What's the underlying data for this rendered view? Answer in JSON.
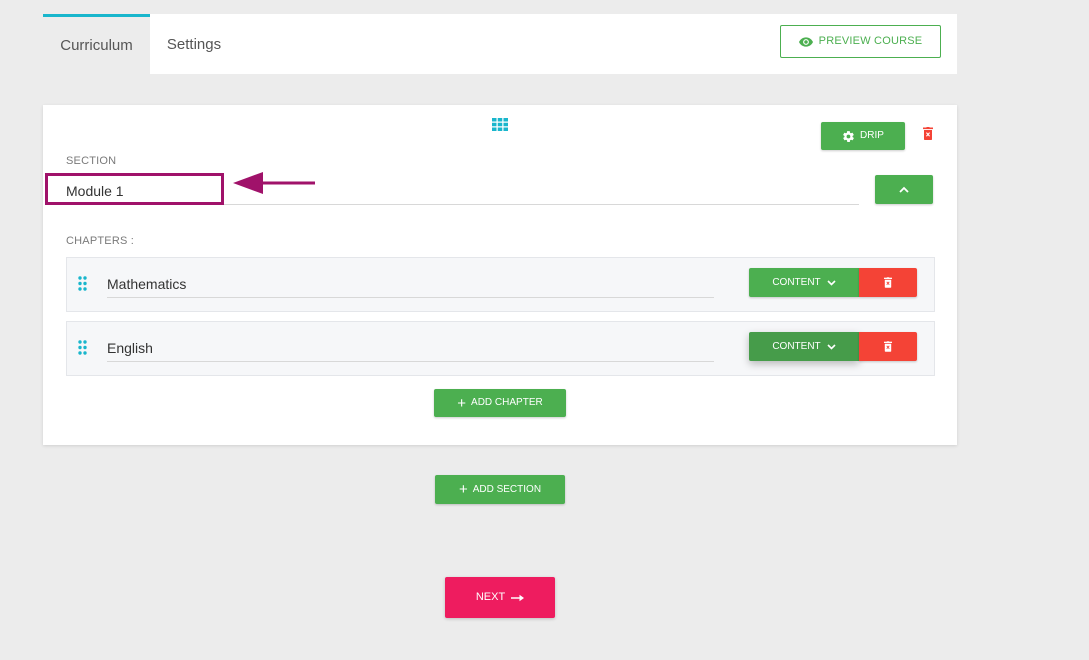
{
  "tabs": [
    {
      "label": "Curriculum",
      "active": true
    },
    {
      "label": "Settings",
      "active": false
    }
  ],
  "header": {
    "preview_label": "PREVIEW COURSE",
    "preview_icon": "eye-icon"
  },
  "section": {
    "label": "SECTION",
    "name": "Module 1",
    "drip_label": "DRIP",
    "drip_icon": "gear-icon",
    "delete_icon": "trash-icon",
    "collapse_icon": "chevron-up-icon",
    "reorder_icon": "grid-icon",
    "chapters_label": "CHAPTERS :",
    "chapters": [
      {
        "name": "Mathematics",
        "content_label": "CONTENT",
        "content_icon": "chevron-down-icon",
        "delete_icon": "trash-icon"
      },
      {
        "name": "English",
        "content_label": "CONTENT",
        "content_icon": "chevron-down-icon",
        "delete_icon": "trash-icon"
      }
    ],
    "add_chapter_label": "ADD CHAPTER"
  },
  "add_section_label": "ADD SECTION",
  "next_label": "NEXT",
  "annotation": {
    "highlight_color": "#a0126a",
    "arrow_icon": "arrow-left-icon"
  },
  "colors": {
    "accent_teal": "#19b6cc",
    "green": "#4caf50",
    "red": "#f44336",
    "pink": "#ee1c5f"
  }
}
